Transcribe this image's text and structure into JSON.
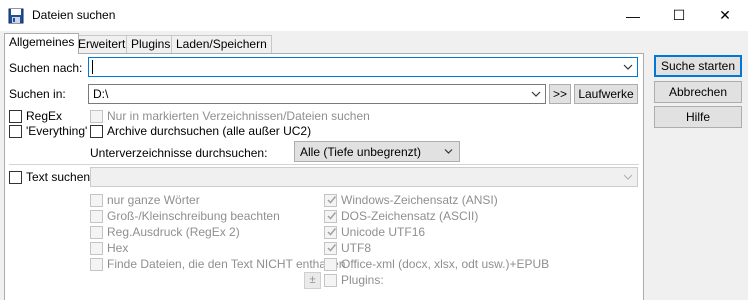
{
  "window": {
    "title": "Dateien suchen",
    "minimize": "—",
    "maximize": "☐",
    "close": "✕"
  },
  "tabs": [
    "Allgemeines",
    "Erweitert",
    "Plugins",
    "Laden/Speichern"
  ],
  "search_for": {
    "label": "Suchen nach:",
    "value": ""
  },
  "search_in": {
    "label": "Suchen in:",
    "value": "D:\\",
    "browse_label": ">>",
    "drives_label": "Laufwerke"
  },
  "options": {
    "regex": "RegEx",
    "everything": "'Everything'",
    "only_marked": "Nur in markierten Verzeichnissen/Dateien suchen",
    "archives": "Archive durchsuchen (alle außer UC2)"
  },
  "subdirs": {
    "label": "Unterverzeichnisse durchsuchen:",
    "value": "Alle (Tiefe unbegrenzt)"
  },
  "text_search": {
    "label": "Text suchen:",
    "value": "",
    "left_options": [
      "nur ganze Wörter",
      "Groß-/Kleinschreibung beachten",
      "Reg.Ausdruck (RegEx 2)",
      "Hex",
      "Finde Dateien, die den Text NICHT enthalten"
    ],
    "right_options": [
      "Windows-Zeichensatz (ANSI)",
      "DOS-Zeichensatz (ASCII)",
      "Unicode UTF16",
      "UTF8",
      "Office-xml (docx, xlsx, odt usw.)+EPUB",
      "Plugins:"
    ],
    "plusminus": "±"
  },
  "buttons": {
    "start": "Suche starten",
    "cancel": "Abbrechen",
    "help": "Hilfe"
  }
}
